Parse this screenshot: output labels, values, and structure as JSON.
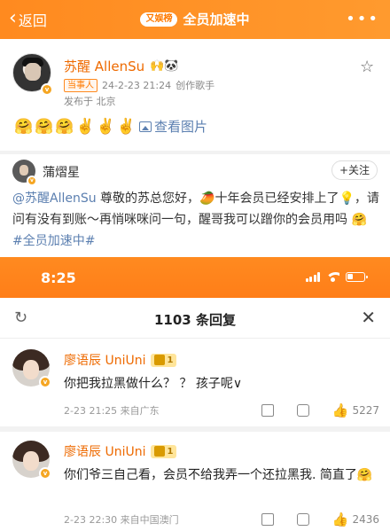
{
  "topbar": {
    "back_label": "返回",
    "topic_badge": "又娱榜",
    "topic_title": "全员加速中",
    "more_label": "•••"
  },
  "post": {
    "author": "苏醒 AllenSu",
    "name_emojis": "🙌🐼",
    "role_tag": "当事人",
    "time": "24-2-23 21:24",
    "subtitle": "创作歌手",
    "location": "发布于 北京",
    "emojis": [
      "🤗",
      "🤗",
      "🤗",
      "✌️",
      "✌️",
      "✌️"
    ],
    "view_images": "查看图片"
  },
  "reply": {
    "author": "蒲熠星",
    "follow_label": "+关注",
    "mention": "@苏醒AllenSu",
    "text_part1": " 尊敬的苏总您好，🥭十年会员已经安排上了💡，请问有没有到账～再悄咪咪问一句，醒哥我可以蹭你的会员用吗 🤗 ",
    "hashtag": "#全员加速中#"
  },
  "statusbar": {
    "time": "8:25"
  },
  "sheet": {
    "title": "1103 条回复",
    "comments": [
      {
        "author": "廖语辰 UniUni",
        "level": "1",
        "text": "你把我拉黑做什么？ ？ 孩子呢∨",
        "time": "2-23 21:25 来自广东",
        "likes": "5227"
      },
      {
        "author": "廖语辰 UniUni",
        "level": "1",
        "text": "你们爷三自己看，会员不给我弄一个还拉黑我. 简直了🤗",
        "time": "2-23 22:30 来自中国澳门",
        "likes": "2436"
      }
    ]
  },
  "colors": {
    "brand_orange": "#ff8a1f",
    "link_blue": "#5b7fb0",
    "name_orange": "#ee6a00"
  }
}
